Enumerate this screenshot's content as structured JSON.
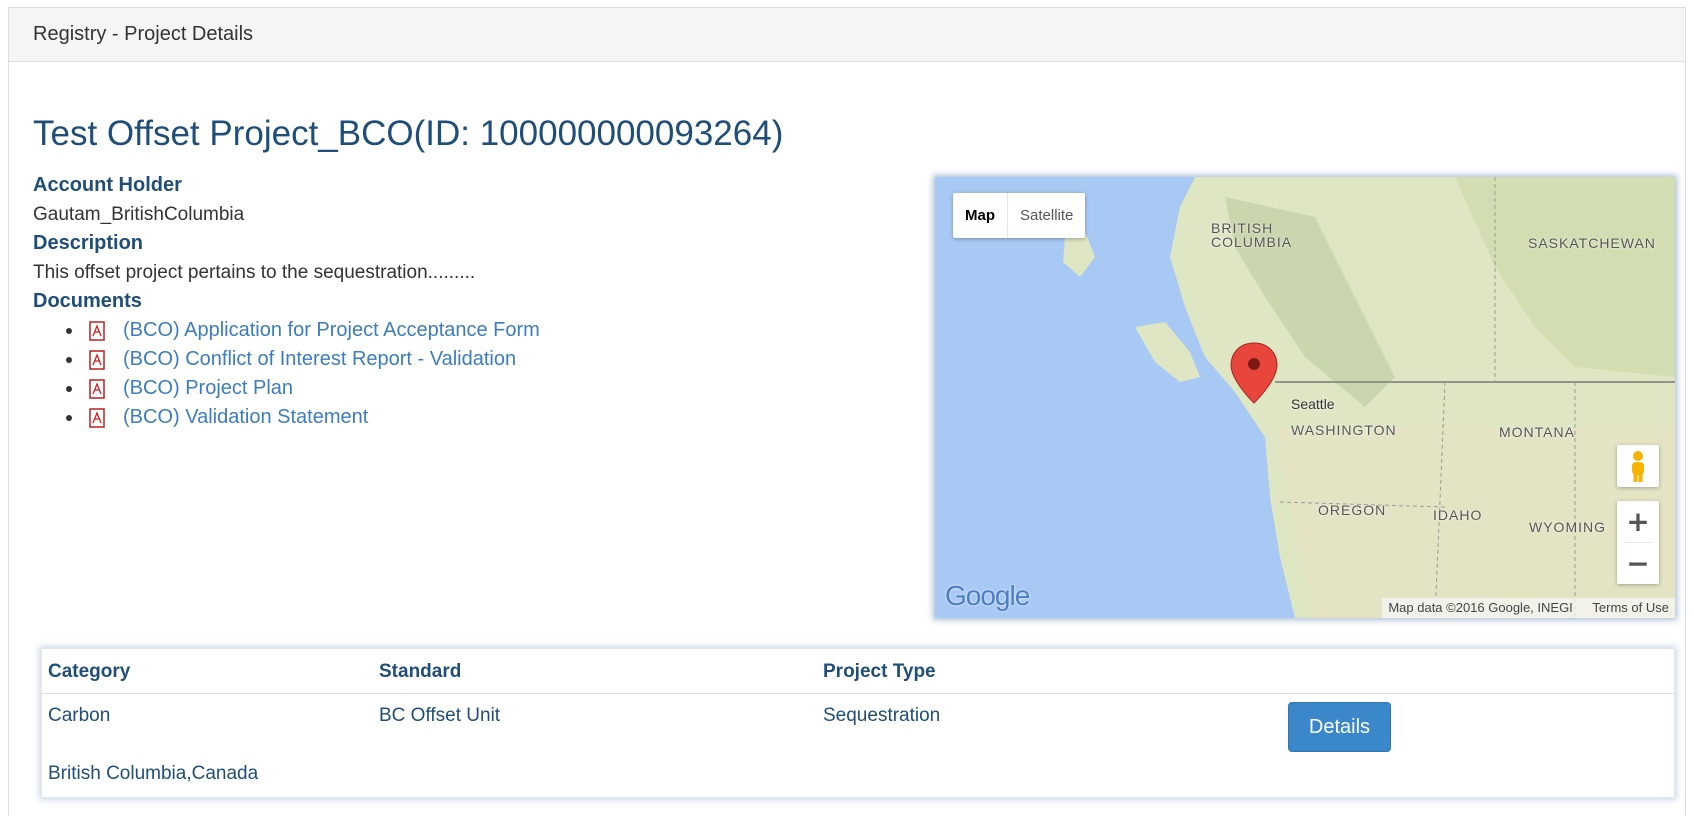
{
  "panel": {
    "heading": "Registry - Project Details"
  },
  "project": {
    "title": "Test Offset Project_BCO(ID: 100000000093264)",
    "account_holder_label": "Account Holder",
    "account_holder": "Gautam_BritishColumbia",
    "description_label": "Description",
    "description": "This offset project pertains to the sequestration.........",
    "documents_label": "Documents",
    "documents": [
      "(BCO) Application for Project Acceptance Form",
      "(BCO) Conflict of Interest Report - Validation",
      "(BCO) Project Plan",
      "(BCO) Validation Statement"
    ]
  },
  "map": {
    "type_map": "Map",
    "type_satellite": "Satellite",
    "labels": {
      "british_columbia": "BRITISH\nCOLUMBIA",
      "saskatchewan": "SASKATCHEWAN",
      "seattle": "Seattle",
      "washington": "WASHINGTON",
      "montana": "MONTANA",
      "oregon": "OREGON",
      "idaho": "IDAHO",
      "wyoming": "WYOMING"
    },
    "zoom_in": "+",
    "zoom_out": "−",
    "logo": "Google",
    "attribution": "Map data ©2016 Google, INEGI",
    "terms": "Terms of Use",
    "colors": {
      "water": "#a9c9f5",
      "land": "#dfe6c4",
      "marker": "#e8453c"
    }
  },
  "table": {
    "headers": [
      "Category",
      "Standard",
      "Project Type"
    ],
    "row": {
      "category": "Carbon",
      "standard": "BC Offset Unit",
      "project_type": "Sequestration",
      "location": "British Columbia,Canada"
    },
    "details_label": "Details"
  },
  "colors": {
    "heading_blue": "#1f4e79",
    "link_blue": "#3b7dbf",
    "button_blue": "#3a87c9"
  }
}
